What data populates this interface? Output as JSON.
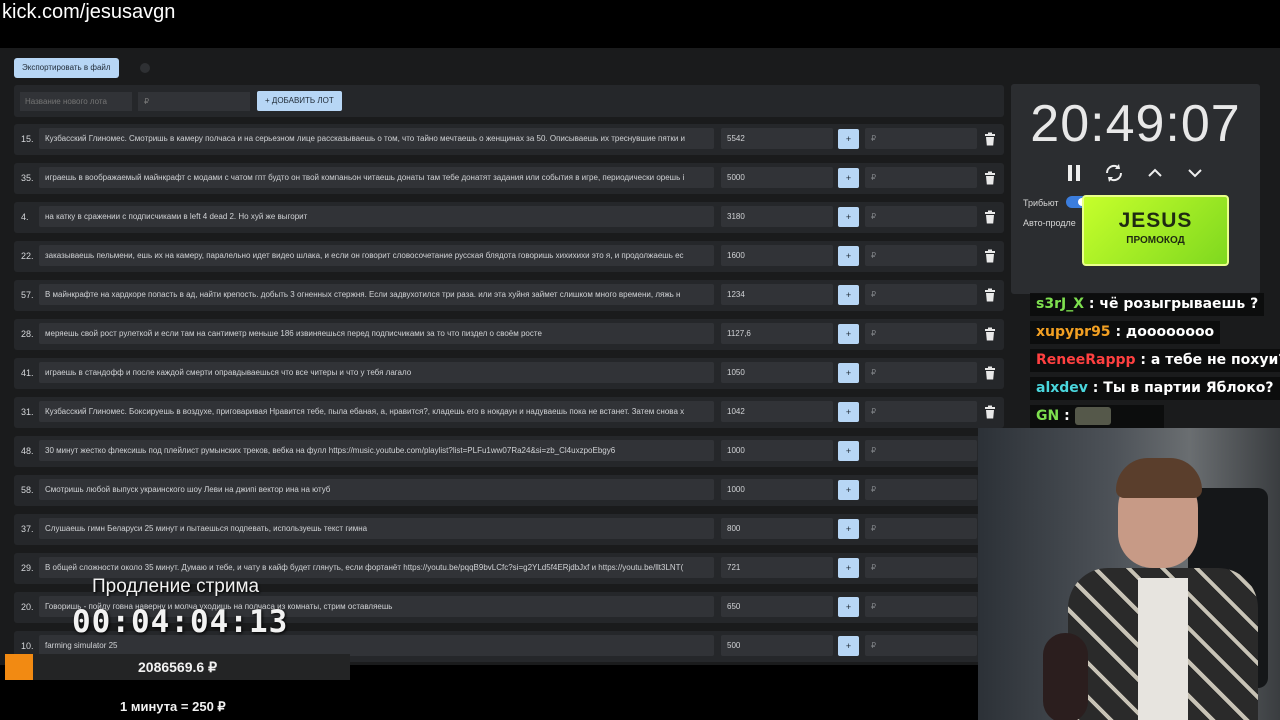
{
  "browser": {
    "url": "kick.com/jesusavgn"
  },
  "toolbar": {
    "export_label": "Экспортировать в файл"
  },
  "add_form": {
    "name_placeholder": "Название нового лота",
    "price_placeholder": "₽",
    "add_label": "+ ДОБАВИТЬ ЛОТ"
  },
  "lots": [
    {
      "num": "15.",
      "text": "Кузбасский Глиномес. Смотришь в камеру полчаса и на серьезном лице рассказываешь о том, что тайно мечтаешь о женщинах за 50. Описываешь их треснувшие пятки и",
      "amount": "5542",
      "plus": "+",
      "price": "₽"
    },
    {
      "num": "35.",
      "text": "играешь в воображаемый майнкрафт с модами с чатом гпт будто он твой компаньон читаешь донаты там тебе донатят задания или события в игре, периодически орешь i",
      "amount": "5000",
      "plus": "+",
      "price": "₽"
    },
    {
      "num": "4.",
      "text": "на катку в сражении с подписчиками в left 4 dead 2. Но хуй же выгорит",
      "amount": "3180",
      "plus": "+",
      "price": "₽"
    },
    {
      "num": "22.",
      "text": "заказываешь пельмени, ешь их на камеру, паралельно идет видео шлака, и если он говорит словосочетание русская блядота говоришь хихихихи это я, и продолжаешь ес",
      "amount": "1600",
      "plus": "+",
      "price": "₽"
    },
    {
      "num": "57.",
      "text": "В майнкрафте на хардкоре попасть в ад, найти крепость. добыть 3 огненных стержня. Если задвухотился три раза. или эта хуйня займет слишком много времени, ляжь н",
      "amount": "1234",
      "plus": "+",
      "price": "₽"
    },
    {
      "num": "28.",
      "text": "меряешь свой рост рулеткой и если там на сантиметр меньше 186 извиняешься перед подписчиками за то что пиздел о своём росте",
      "amount": "1127,6",
      "plus": "+",
      "price": "₽"
    },
    {
      "num": "41.",
      "text": "играешь в стандофф и после каждой смерти оправдываешься что все читеры и что у тебя лагало",
      "amount": "1050",
      "plus": "+",
      "price": "₽"
    },
    {
      "num": "31.",
      "text": "Кузбасский Глиномес. Боксируешь в воздухе, приговаривая Нравится тебе, пыла ебаная, а, нравится?, кладешь его в нокдаун и надуваешь пока не встанет. Затем снова х",
      "amount": "1042",
      "plus": "+",
      "price": "₽"
    },
    {
      "num": "48.",
      "text": "30 минут жестко флексишь под плейлист румынских треков, вебка на фулл https://music.youtube.com/playlist?list=PLFu1ww07Ra24&si=zb_Cl4uxzpoEbgy6",
      "amount": "1000",
      "plus": "+",
      "price": "₽"
    },
    {
      "num": "58.",
      "text": "Смотришь любой выпуск украинского шоу Леви на джипі вектор ина на ютуб",
      "amount": "1000",
      "plus": "+",
      "price": "₽"
    },
    {
      "num": "37.",
      "text": "Слушаешь гимн Беларуси 25 минут и пытаешься подпевать, используешь текст гимна",
      "amount": "800",
      "plus": "+",
      "price": "₽"
    },
    {
      "num": "29.",
      "text": "В общей сложности около 35 минут. Думаю и тебе, и чату в кайф будет глянуть, если фортанёт https://youtu.be/pqqB9bvLCfc?si=g2YLd5f4ERjdbJxf и https://youtu.be/llt3LNT(",
      "amount": "721",
      "plus": "+",
      "price": "₽"
    },
    {
      "num": "20.",
      "text": "Говоришь - пойду говна наверну и молча уходишь на полчаса из комнаты, стрим оставляешь",
      "amount": "650",
      "plus": "+",
      "price": "₽"
    },
    {
      "num": "10.",
      "text": "farming simulator 25",
      "amount": "500",
      "plus": "+",
      "price": "₽"
    }
  ],
  "timer": {
    "value": "20:49:07",
    "tribute_label": "Трибьют",
    "auto_label": "Авто-продле"
  },
  "promo": {
    "title": "JESUS",
    "subtitle": "ПРОМОКОД"
  },
  "chat": [
    {
      "user": "s3rJ_X",
      "sep": ":",
      "msg": "чё розыгрываешь ?",
      "color": "#7ee04f"
    },
    {
      "user": "xupypr95",
      "sep": ":",
      "msg": "доооооооо",
      "color": "#f2a023"
    },
    {
      "user": "ReneeRappp",
      "sep": ":",
      "msg": "а тебе не похуи?",
      "color": "#ff4040"
    },
    {
      "user": "alxdev",
      "sep": ":",
      "msg": "Ты в партии Яблоко?",
      "color": "#4ad6dc"
    },
    {
      "user": "GN",
      "sep": ":",
      "msg": "",
      "color": "#7ee04f"
    }
  ],
  "overlay": {
    "title": "Продление стрима",
    "countdown": "00:04:04:13",
    "total": "2086569.6 ₽",
    "rate": "1 минута = 250 ₽",
    "progress": 0.08
  },
  "colors": {
    "accent": "#b7d6f5",
    "orange": "#f28a12",
    "panel": "#25272a",
    "input": "#313337"
  }
}
